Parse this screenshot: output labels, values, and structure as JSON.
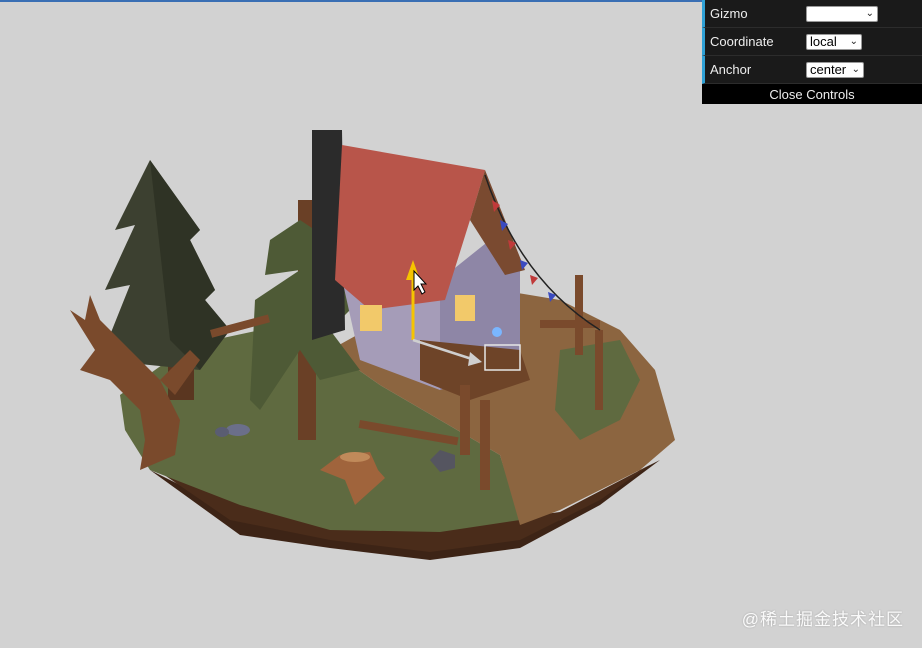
{
  "gui": {
    "rows": [
      {
        "label": "Gizmo",
        "value": ""
      },
      {
        "label": "Coordinate",
        "value": "local"
      },
      {
        "label": "Anchor",
        "value": "center"
      }
    ],
    "close_label": "Close Controls"
  },
  "watermark": "@稀土掘金技术社区",
  "colors": {
    "background": "#d2d2d2",
    "panel": "#1a1a1a",
    "accent": "#2fa1d6",
    "gizmo_axis": "#f5c400"
  },
  "icons": [
    "select-chevron-icon",
    "mouse-cursor-icon"
  ]
}
